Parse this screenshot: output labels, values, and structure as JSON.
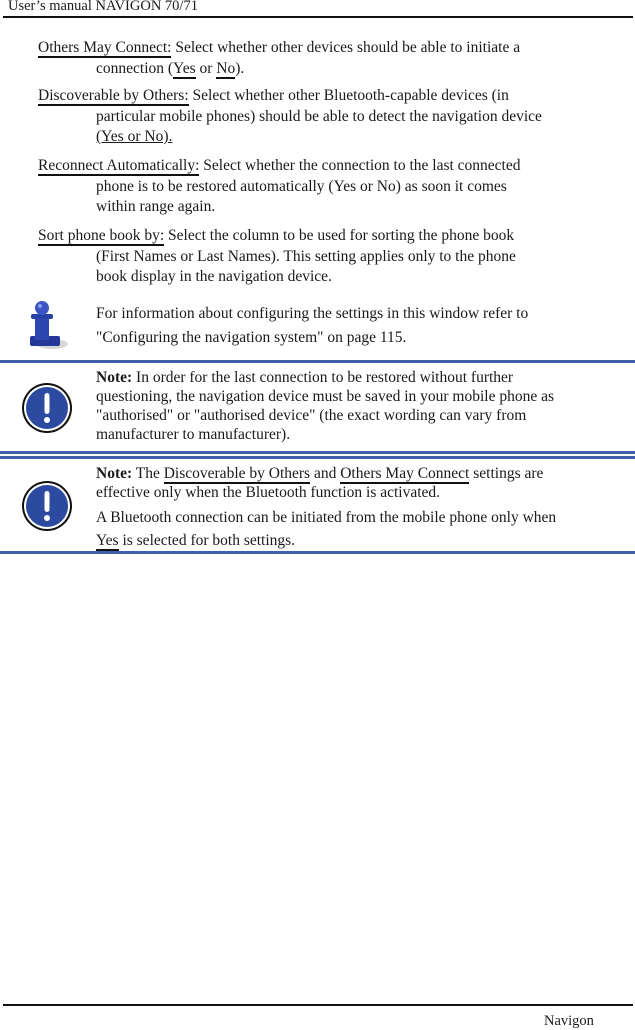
{
  "header": {
    "title": "User’s manual NAVIGON 70/71"
  },
  "entries": [
    {
      "term": "Others May Connect:",
      "line1": " Select whether other devices should be able to initiate a",
      "line2_pre": "connection (",
      "opt1": "Yes",
      "mid": " or ",
      "opt2": "No",
      "line2_post": ")."
    },
    {
      "term": "Discoverable by Others:",
      "line1": " Select whether other Bluetooth-capable devices (in",
      "line2": "particular mobile phones) should be able to detect the navigation device",
      "line3": "(Yes or No)."
    },
    {
      "term": "Reconnect Automatically:",
      "line1": " Select whether the connection to the last connected",
      "line2": "phone is to be restored automatically (Yes or No) as soon it comes",
      "line3": "within range again."
    },
    {
      "term": "Sort phone book by:",
      "line1": " Select the column to be used for sorting the phone book",
      "line2": "(First Names or Last Names). This setting applies only to the phone",
      "line3": "book display in the navigation device."
    }
  ],
  "info_box": {
    "icon": "info-pawn-icon",
    "line1": "For information about configuring the settings in this window refer to",
    "line2": "\"Configuring the navigation system\" on page 115."
  },
  "note1": {
    "icon": "exclamation-icon",
    "label": "Note:",
    "text": " In order for the last connection to be restored without further questioning, the navigation device must be saved in your mobile phone as \"authorised\" or \"authorised device\" (the exact wording can vary from manufacturer to manufacturer)."
  },
  "note2": {
    "icon": "exclamation-icon",
    "label": "Note:",
    "pre": " The ",
    "setting1": "Discoverable by Others",
    "and": " and ",
    "setting2": "Others May Connect",
    "post": " settings are effective only when the Bluetooth function is activated.",
    "para2_pre": "A Bluetooth connection can be initiated from the mobile phone only when ",
    "para2_yes": "Yes",
    "para2_post": " is selected for both settings."
  },
  "footer": {
    "brand": "Navigon"
  },
  "colors": {
    "accent_rule": "#3f5fa8",
    "icon_blue": "#2b4aa0"
  }
}
